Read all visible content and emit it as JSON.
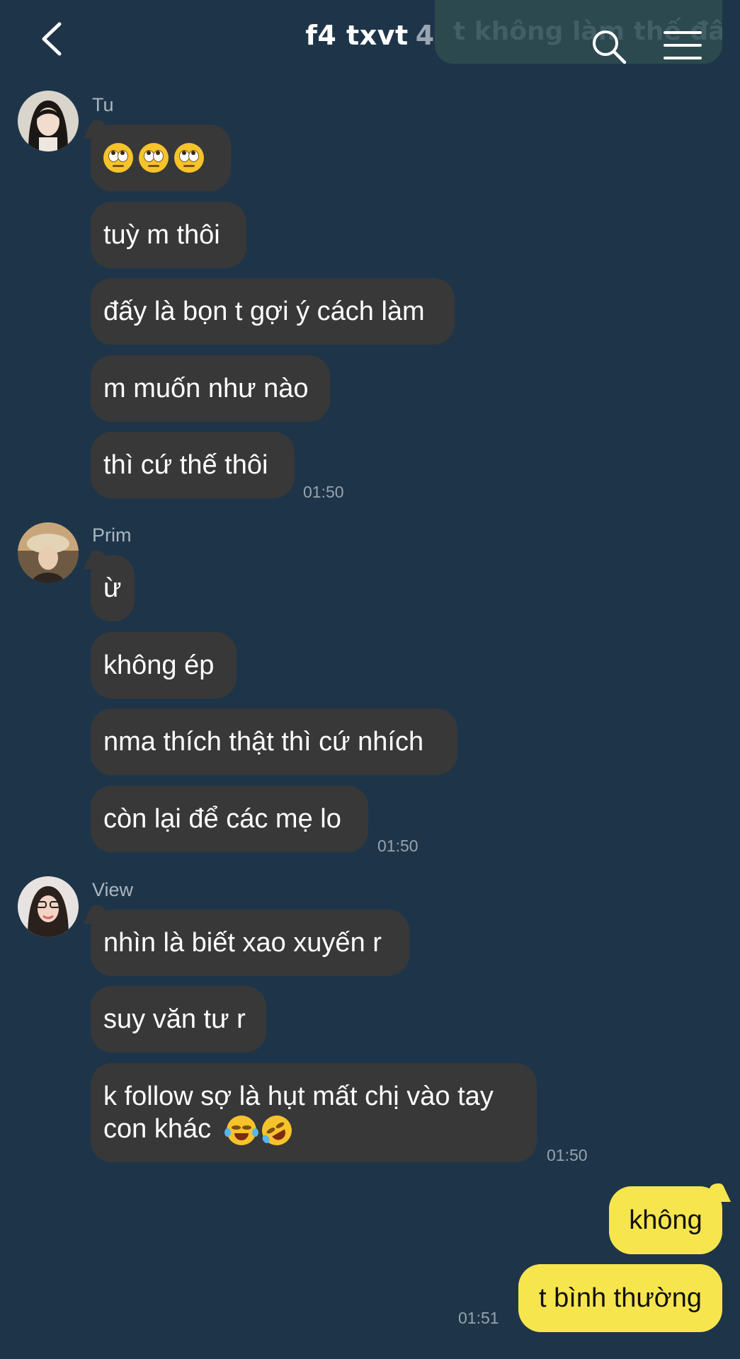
{
  "header": {
    "title": "f4 txvt",
    "member_count": "4",
    "pinned_preview": "t không làm thế đâu",
    "back_icon": "chevron-left-icon",
    "search_icon": "search-icon",
    "menu_icon": "hamburger-menu-icon"
  },
  "colors": {
    "background": "#1e3549",
    "incoming_bubble": "#383838",
    "outgoing_bubble": "#f7e54e"
  },
  "groups": [
    {
      "sender": "Tu",
      "messages": [
        "🙄🙄🙄",
        "tuỳ m thôi",
        "đấy là bọn t gợi ý cách làm",
        "m muốn như nào",
        "thì cứ thế thôi"
      ],
      "time": "01:50"
    },
    {
      "sender": "Prim",
      "messages": [
        "ừ",
        "không ép",
        "nma thích thật thì cứ nhích",
        "còn lại để các mẹ lo"
      ],
      "time": "01:50"
    },
    {
      "sender": "View",
      "messages": [
        "nhìn là biết xao xuyến r",
        "suy văn tư r",
        "k follow sợ là hụt mất chị vào tay con khác"
      ],
      "time": "01:50"
    }
  ],
  "outgoing": {
    "messages": [
      "không",
      "t bình thường"
    ],
    "time": "01:51"
  }
}
